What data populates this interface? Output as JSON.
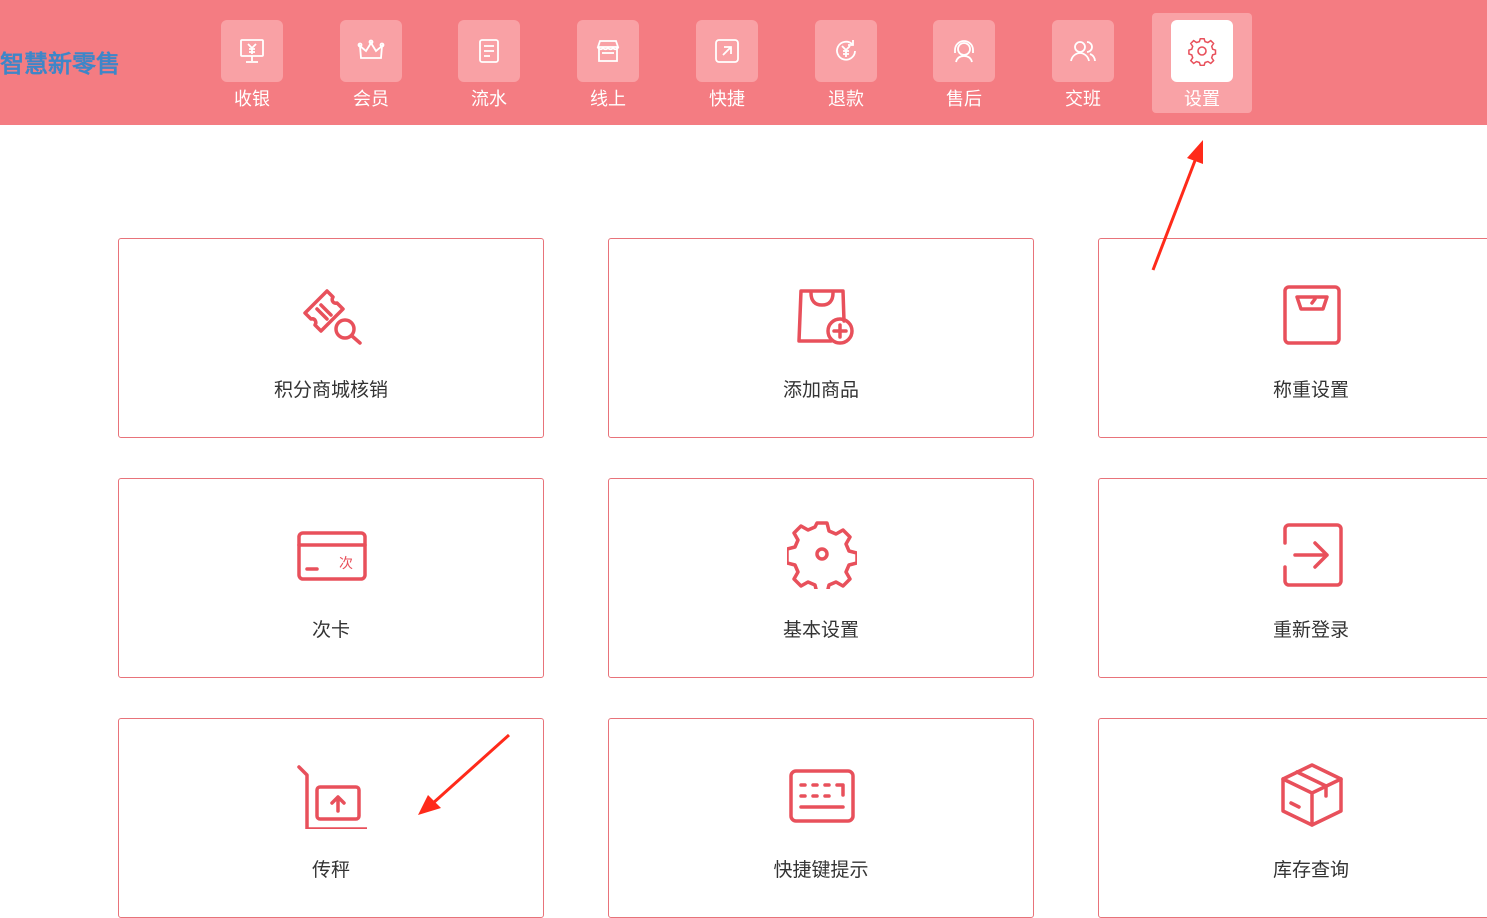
{
  "app": {
    "brand": "智慧新零售"
  },
  "nav": {
    "items": [
      {
        "label": "收银",
        "icon": "cashier-icon",
        "active": false
      },
      {
        "label": "会员",
        "icon": "crown-icon",
        "active": false
      },
      {
        "label": "流水",
        "icon": "ledger-icon",
        "active": false
      },
      {
        "label": "线上",
        "icon": "store-icon",
        "active": false
      },
      {
        "label": "快捷",
        "icon": "shortcut-icon",
        "active": false
      },
      {
        "label": "退款",
        "icon": "refund-icon",
        "active": false
      },
      {
        "label": "售后",
        "icon": "headset-icon",
        "active": false
      },
      {
        "label": "交班",
        "icon": "handover-icon",
        "active": false
      },
      {
        "label": "设置",
        "icon": "gear-icon",
        "active": true
      }
    ]
  },
  "cards": [
    {
      "label": "积分商城核销",
      "icon": "ticket-search-icon"
    },
    {
      "label": "添加商品",
      "icon": "bag-add-icon"
    },
    {
      "label": "称重设置",
      "icon": "scale-icon"
    },
    {
      "label": "次卡",
      "icon": "card-icon",
      "card_text": "次"
    },
    {
      "label": "基本设置",
      "icon": "gear-icon"
    },
    {
      "label": "重新登录",
      "icon": "login-icon"
    },
    {
      "label": "传秤",
      "icon": "upload-scale-icon"
    },
    {
      "label": "快捷键提示",
      "icon": "keyboard-icon"
    },
    {
      "label": "库存查询",
      "icon": "box-icon"
    }
  ],
  "colors": {
    "header": "#f47c82",
    "accent": "#e8505b",
    "brand_text": "#3e86c8",
    "annotation": "#ff2a1a"
  }
}
